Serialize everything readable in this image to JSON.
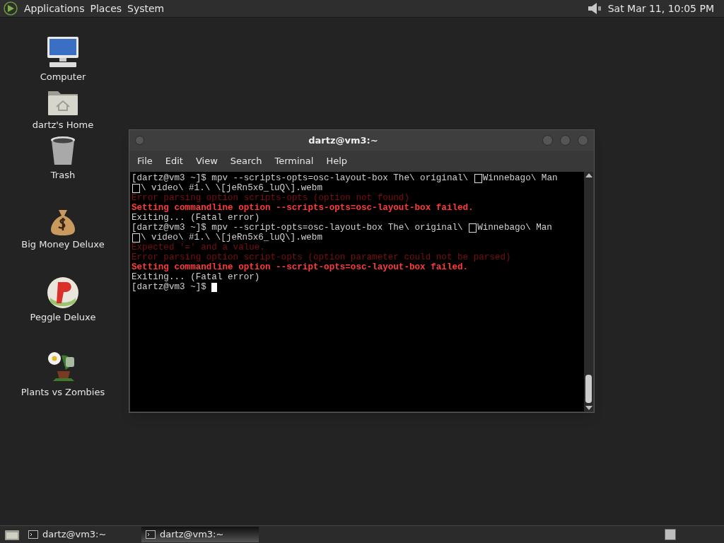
{
  "top_panel": {
    "menus": [
      "Applications",
      "Places",
      "System"
    ],
    "clock": "Sat Mar 11, 10:05 PM"
  },
  "desktop_icons": [
    {
      "kind": "computer",
      "label": "Computer"
    },
    {
      "kind": "home",
      "label": "dartz's Home"
    },
    {
      "kind": "trash",
      "label": "Trash"
    },
    {
      "kind": "money",
      "label": "Big Money Deluxe"
    },
    {
      "kind": "peggle",
      "label": "Peggle Deluxe"
    },
    {
      "kind": "plants",
      "label": "Plants vs Zombies"
    }
  ],
  "window": {
    "title": "dartz@vm3:~",
    "menus": [
      "File",
      "Edit",
      "View",
      "Search",
      "Terminal",
      "Help"
    ],
    "lines": [
      {
        "kind": "plain",
        "segments": [
          {
            "kind": "text",
            "text": "[dartz@vm3 ~]$ mpv --scripts-opts=osc-layout-box The\\ original\\ "
          },
          {
            "kind": "missing_glyph"
          },
          {
            "kind": "text",
            "text": "Winnebago\\ Man"
          }
        ]
      },
      {
        "kind": "plain",
        "segments": [
          {
            "kind": "missing_glyph"
          },
          {
            "kind": "text",
            "text": "\\ video\\ #1.\\ \\[jeRn5x6_luQ\\].webm"
          }
        ]
      },
      {
        "kind": "error_dim",
        "segments": [
          {
            "kind": "text",
            "text": "Error parsing option scripts-opts (option not found)"
          }
        ]
      },
      {
        "kind": "error_bold",
        "segments": [
          {
            "kind": "text",
            "text": "Setting commandline option --scripts-opts=osc-layout-box failed."
          }
        ]
      },
      {
        "kind": "plain",
        "segments": [
          {
            "kind": "text",
            "text": "Exiting... (Fatal error)"
          }
        ]
      },
      {
        "kind": "plain",
        "segments": [
          {
            "kind": "text",
            "text": "[dartz@vm3 ~]$ mpv --script-opts=osc-layout-box The\\ original\\ "
          },
          {
            "kind": "missing_glyph"
          },
          {
            "kind": "text",
            "text": "Winnebago\\ Man"
          }
        ]
      },
      {
        "kind": "plain",
        "segments": [
          {
            "kind": "missing_glyph"
          },
          {
            "kind": "text",
            "text": "\\ video\\ #1.\\ \\[jeRn5x6_luQ\\].webm"
          }
        ]
      },
      {
        "kind": "error_dim",
        "segments": [
          {
            "kind": "text",
            "text": "Expected '=' and a value."
          }
        ]
      },
      {
        "kind": "error_dim",
        "segments": [
          {
            "kind": "text",
            "text": "Error parsing option script-opts (option parameter could not be parsed)"
          }
        ]
      },
      {
        "kind": "error_bold",
        "segments": [
          {
            "kind": "text",
            "text": "Setting commandline option --script-opts=osc-layout-box failed."
          }
        ]
      },
      {
        "kind": "plain",
        "segments": [
          {
            "kind": "text",
            "text": "Exiting... (Fatal error)"
          }
        ]
      },
      {
        "kind": "plain",
        "segments": [
          {
            "kind": "text",
            "text": "[dartz@vm3 ~]$ "
          },
          {
            "kind": "cursor"
          }
        ]
      }
    ]
  },
  "taskbar": {
    "tasks": [
      {
        "label": "dartz@vm3:~",
        "selected": false
      },
      {
        "label": "dartz@vm3:~",
        "selected": true
      }
    ]
  }
}
